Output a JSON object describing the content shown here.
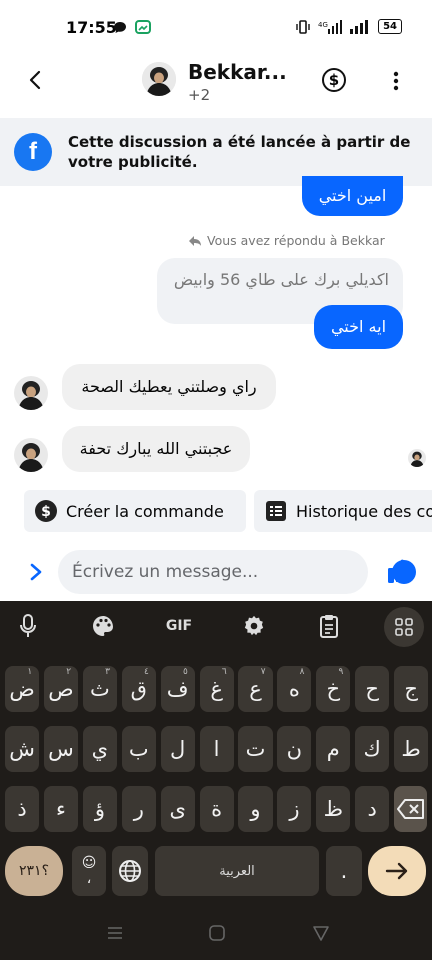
{
  "status_bar": {
    "time": "17:55",
    "battery": "54"
  },
  "header": {
    "title": "Bekkar...",
    "subtitle": "+2"
  },
  "banner": {
    "text": "Cette discussion a été lancée à partir de votre publicité."
  },
  "messages": {
    "m1": "امين اختي",
    "reply_label": "Vous avez répondu à Bekkar",
    "quoted": "اكديلي برك على طاي 56 وابيض",
    "m2": "ايه اختي",
    "m3": "راي وصلتني يعطيك الصحة",
    "m4": "عجبتني الله يبارك تحفة"
  },
  "chips": {
    "create_order": "Créer la commande",
    "history": "Historique des commandes"
  },
  "composer": {
    "placeholder": "Écrivez un message..."
  },
  "keyboard": {
    "tools": {
      "gif": "GIF"
    },
    "row1": [
      {
        "k": "ض",
        "h": "١"
      },
      {
        "k": "ص",
        "h": "٢"
      },
      {
        "k": "ث",
        "h": "٣"
      },
      {
        "k": "ق",
        "h": "٤"
      },
      {
        "k": "ف",
        "h": "٥"
      },
      {
        "k": "غ",
        "h": "٦"
      },
      {
        "k": "ع",
        "h": "٧"
      },
      {
        "k": "ه",
        "h": "٨"
      },
      {
        "k": "خ",
        "h": "٩"
      },
      {
        "k": "ح",
        "h": ""
      },
      {
        "k": "ج",
        "h": ""
      }
    ],
    "row2": [
      "ش",
      "س",
      "ي",
      "ب",
      "ل",
      "ا",
      "ت",
      "ن",
      "م",
      "ك",
      "ط"
    ],
    "row3": [
      "ذ",
      "ء",
      "ؤ",
      "ر",
      "ى",
      "ة",
      "و",
      "ز",
      "ظ",
      "د"
    ],
    "numbers_key": "؟٢٣١",
    "comma_key": "،",
    "space_label": "العربية",
    "period_key": "."
  }
}
